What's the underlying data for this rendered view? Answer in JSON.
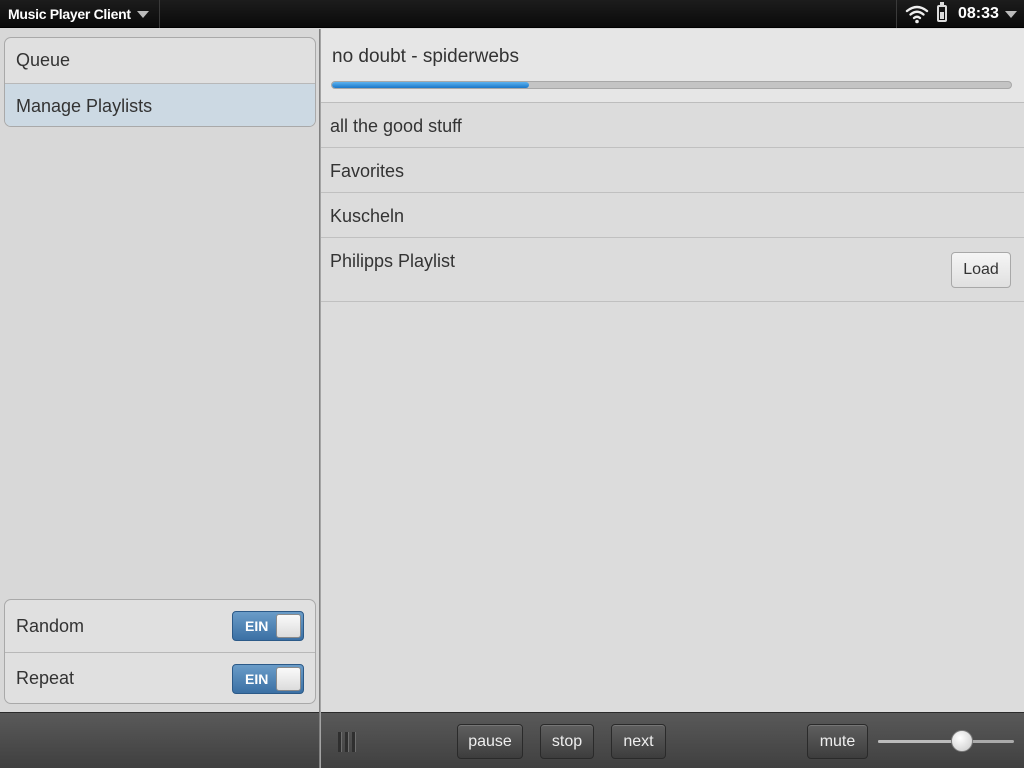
{
  "status_bar": {
    "app_title": "Music Player Client",
    "time": "08:33",
    "icons": [
      "chevron-down-icon",
      "wifi-icon",
      "battery-icon",
      "chevron-down-icon"
    ]
  },
  "sidebar": {
    "nav_items": [
      {
        "label": "Queue",
        "selected": false
      },
      {
        "label": "Manage Playlists",
        "selected": true
      }
    ],
    "toggles": [
      {
        "label": "Random",
        "state": "EIN"
      },
      {
        "label": "Repeat",
        "state": "EIN"
      }
    ]
  },
  "now_playing": {
    "title": "no doubt - spiderwebs",
    "progress": 0.29
  },
  "playlists": [
    {
      "name": "all the good stuff"
    },
    {
      "name": "Favorites"
    },
    {
      "name": "Kuscheln"
    },
    {
      "name": "Philipps Playlist",
      "action": "Load"
    }
  ],
  "toolbar": {
    "pause": "pause",
    "stop": "stop",
    "next": "next",
    "mute": "mute",
    "volume": 0.62
  },
  "colors": {
    "accent_blue": "#1b78c9",
    "toggle_blue": "#3b70a4",
    "selected_row": "#ccd9e3"
  }
}
